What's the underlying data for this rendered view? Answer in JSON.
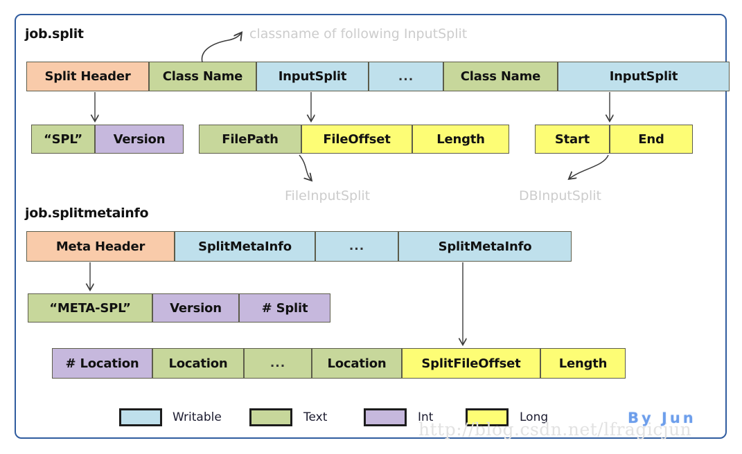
{
  "diagram": {
    "title_section_1": "job.split",
    "title_section_2": "job.splitmetainfo",
    "notes": {
      "classname": "classname of following InputSplit",
      "file_input_split": "FileInputSplit",
      "db_input_split": "DBInputSplit"
    },
    "watermark_url": "http://blog.csdn.net/lfragicjun",
    "watermark_author": "By Jun",
    "frame_color": "#2f5b9e"
  },
  "rows": {
    "job_split": [
      {
        "label": "Split Header",
        "type": "header"
      },
      {
        "label": "Class Name",
        "type": "text"
      },
      {
        "label": "InputSplit",
        "type": "writable"
      },
      {
        "label": "...",
        "type": "writable"
      },
      {
        "label": "Class Name",
        "type": "text"
      },
      {
        "label": "InputSplit",
        "type": "writable"
      }
    ],
    "split_header_detail": [
      {
        "label": "“SPL”",
        "type": "text"
      },
      {
        "label": "Version",
        "type": "int"
      }
    ],
    "file_input_split_detail": [
      {
        "label": "FilePath",
        "type": "text"
      },
      {
        "label": "FileOffset",
        "type": "long"
      },
      {
        "label": "Length",
        "type": "long"
      }
    ],
    "db_input_split_detail": [
      {
        "label": "Start",
        "type": "long"
      },
      {
        "label": "End",
        "type": "long"
      }
    ],
    "job_splitmetainfo": [
      {
        "label": "Meta Header",
        "type": "header"
      },
      {
        "label": "SplitMetaInfo",
        "type": "writable"
      },
      {
        "label": "...",
        "type": "writable"
      },
      {
        "label": "SplitMetaInfo",
        "type": "writable"
      }
    ],
    "meta_header_detail": [
      {
        "label": "“META-SPL”",
        "type": "text"
      },
      {
        "label": "Version",
        "type": "int"
      },
      {
        "label": "# Split",
        "type": "int"
      }
    ],
    "split_meta_info_detail": [
      {
        "label": "# Location",
        "type": "int"
      },
      {
        "label": "Location",
        "type": "text"
      },
      {
        "label": "...",
        "type": "text"
      },
      {
        "label": "Location",
        "type": "text"
      },
      {
        "label": "SplitFileOffset",
        "type": "long"
      },
      {
        "label": "Length",
        "type": "long"
      }
    ]
  },
  "legend": [
    {
      "label": "Writable",
      "color": "#bfe0ec"
    },
    {
      "label": "Text",
      "color": "#c7d79b"
    },
    {
      "label": "Int",
      "color": "#c6b8dd"
    },
    {
      "label": "Long",
      "color": "#fdfd75"
    }
  ]
}
